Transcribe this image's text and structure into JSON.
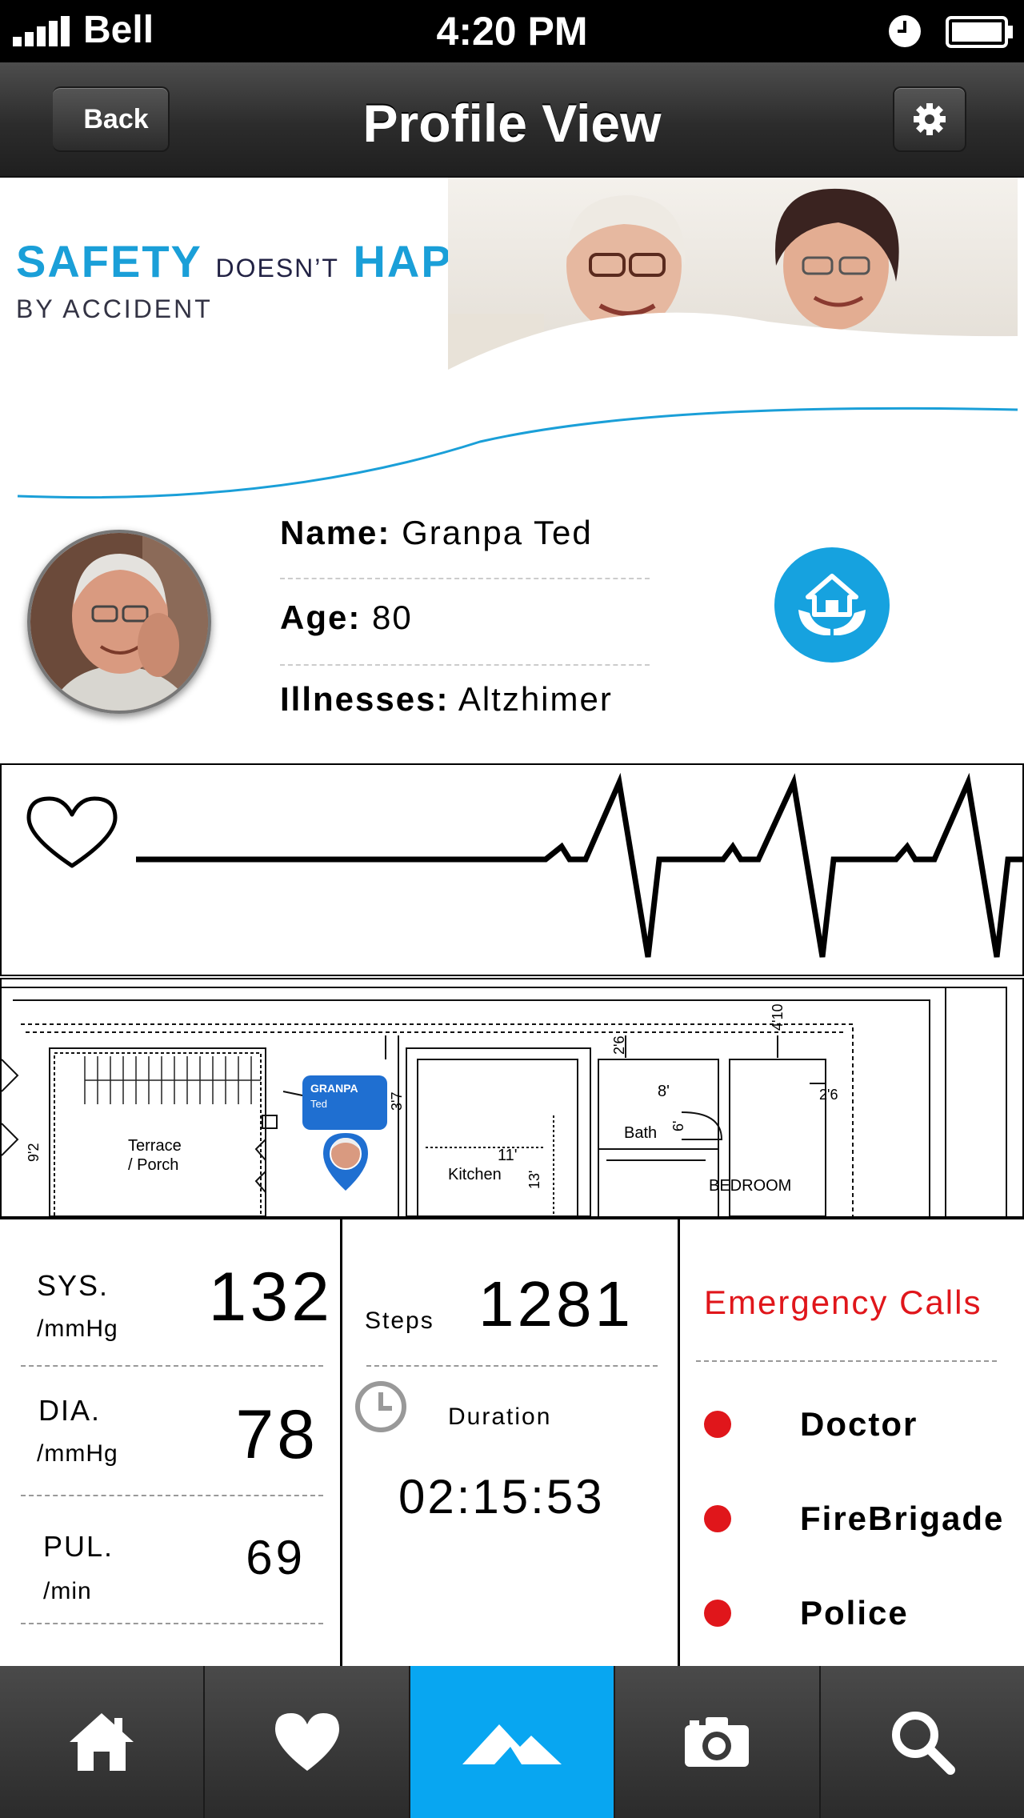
{
  "status_bar": {
    "carrier": "Bell",
    "time": "4:20 PM",
    "signal_icon": "signal-bars-icon",
    "alarm_icon": "clock-icon",
    "battery_icon": "battery-icon"
  },
  "nav": {
    "back_label": "Back",
    "title": "Profile View",
    "settings_icon": "gear-icon"
  },
  "banner": {
    "line1_a": "SAFETY",
    "line1_b": "DOESN’T",
    "line1_c": "HAPPEN",
    "line2": "BY ACCIDENT",
    "accent_color": "#1a9fd8"
  },
  "profile": {
    "name_label": "Name:",
    "name_value": "Granpa Ted",
    "age_label": "Age:",
    "age_value": "80",
    "illness_label": "Illnesses:",
    "illness_value": "Altzhimer",
    "home_icon": "home-hands-icon"
  },
  "ecg": {
    "heart_icon": "heart-outline-icon"
  },
  "floorplan": {
    "labels": {
      "terrace": "Terrace",
      "porch": "/ Porch",
      "kitchen": "Kitchen",
      "bath": "Bath",
      "bedroom": "BEDROOM",
      "dim_11": "11'",
      "dim_13": "13'",
      "dim_8": "8'",
      "dim_6": "6'",
      "dim_26a": "2'6",
      "dim_26b": "2'6",
      "dim_410": "4'10",
      "dim_37": "3'7",
      "dim_92": "9'2"
    },
    "pin": {
      "line1": "GRANPA",
      "line2": "Ted"
    }
  },
  "vitals": {
    "sys_label": "SYS.",
    "sys_unit": "/mmHg",
    "sys_value": "132",
    "dia_label": "DIA.",
    "dia_unit": "/mmHg",
    "dia_value": "78",
    "pul_label": "PUL.",
    "pul_unit": "/min",
    "pul_value": "69"
  },
  "activity": {
    "steps_label": "Steps",
    "steps_value": "1281",
    "duration_label": "Duration",
    "duration_value": "02:15:53"
  },
  "emergency": {
    "title": "Emergency Calls",
    "items": [
      "Doctor",
      "FireBrigade",
      "Police"
    ],
    "color": "#e0161b"
  },
  "tabs": {
    "items": [
      "home-icon",
      "heart-icon",
      "mountain-icon",
      "camera-icon",
      "search-icon"
    ],
    "active_index": 2,
    "active_color": "#08a6f1"
  }
}
